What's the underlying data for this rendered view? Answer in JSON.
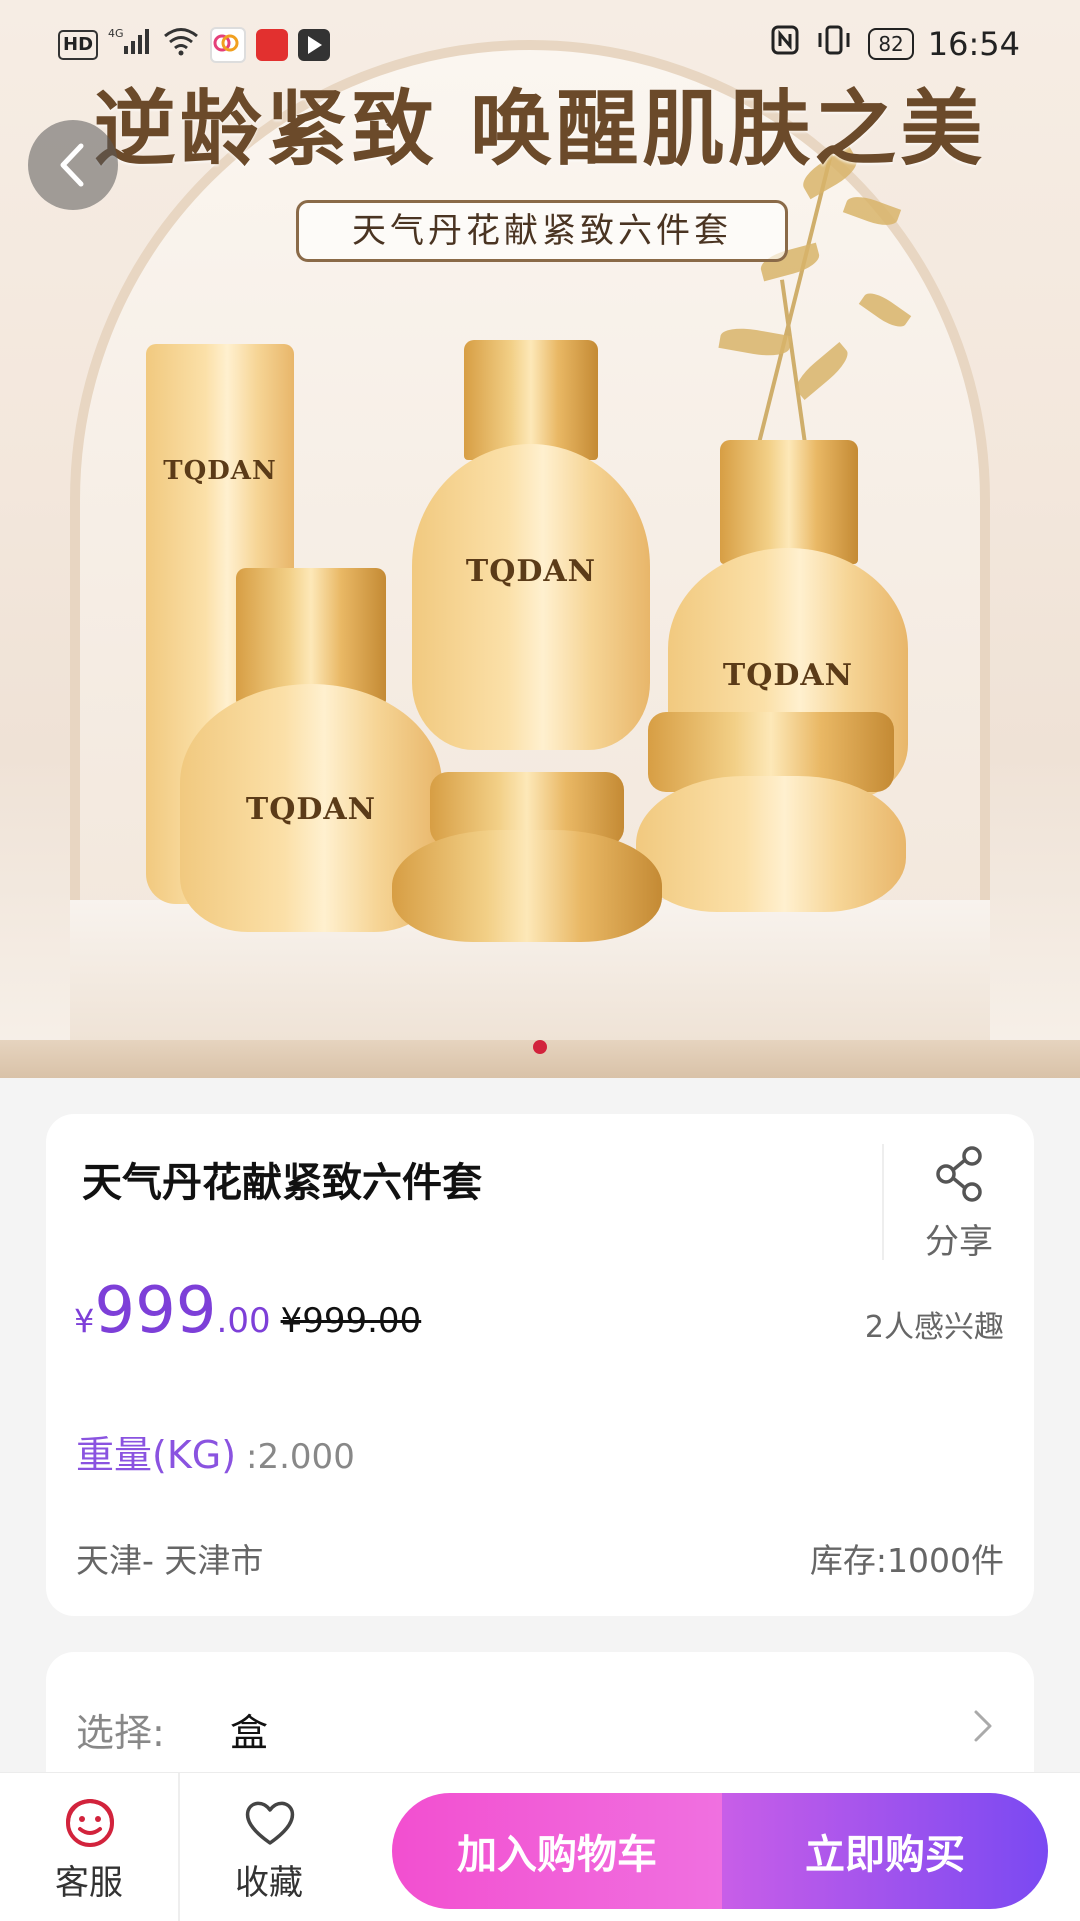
{
  "status_bar": {
    "left_icons": [
      "hd-icon",
      "4g-signal-icon",
      "wifi-icon",
      "app-icon-1",
      "app-icon-2",
      "app-icon-3"
    ],
    "hd_label": "HD",
    "battery": "82",
    "time": "16:54"
  },
  "hero": {
    "headline": "逆龄紧致 唤醒肌肤之美",
    "subtitle": "天气丹花献紧致六件套",
    "brand": "TQDAN",
    "slide_count": 1,
    "active_slide": 1
  },
  "product": {
    "title": "天气丹花献紧致六件套",
    "share_label": "分享",
    "currency": "¥",
    "price_int": "999",
    "price_dec": ".00",
    "original_price": "¥999.00",
    "interest": "2人感兴趣",
    "weight_label": "重量(KG)",
    "weight_value": ":2.000",
    "location": "天津- 天津市",
    "stock": "库存:1000件"
  },
  "spec": {
    "label": "选择:",
    "value": "盒"
  },
  "bottom_bar": {
    "service": "客服",
    "collect": "收藏",
    "add_to_cart": "加入购物车",
    "buy_now": "立即购买"
  },
  "colors": {
    "accent_purple": "#7d3fd8",
    "cart_pink": "#f24fd0",
    "buy_violet": "#7a49f2",
    "service_red": "#d2233c"
  }
}
